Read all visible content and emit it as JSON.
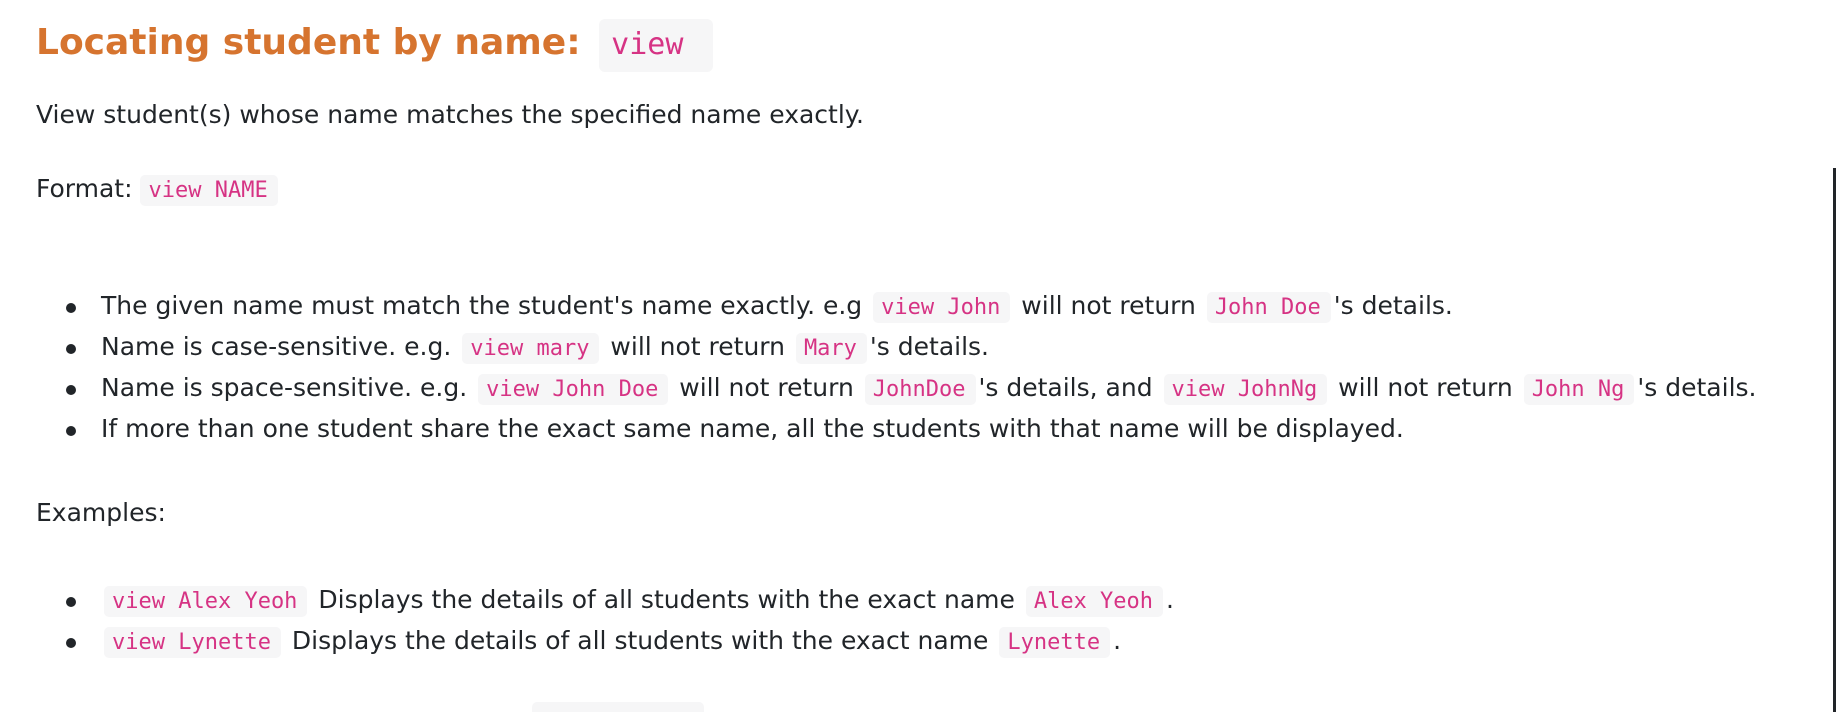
{
  "heading": {
    "text": "Locating student by name:",
    "command": "view"
  },
  "description": "View student(s) whose name matches the specified name exactly.",
  "format": {
    "label": "Format:",
    "code": "view NAME"
  },
  "rules": [
    {
      "t1": "The given name must match the student's name exactly. e.g",
      "c1": "view John",
      "t2": "will not return",
      "c2": "John Doe",
      "t3": "'s details."
    },
    {
      "t1": "Name is case-sensitive. e.g.",
      "c1": "view mary",
      "t2": "will not return",
      "c2": "Mary",
      "t3": "'s details."
    },
    {
      "t1": "Name is space-sensitive. e.g.",
      "c1": "view John Doe",
      "t2": "will not return",
      "c2": "JohnDoe",
      "t3": "'s details, and",
      "c3": "view JohnNg",
      "t4": "will not return",
      "c4": "John Ng",
      "t5": "'s details."
    },
    {
      "t1": "If more than one student share the exact same name, all the students with that name will be displayed."
    }
  ],
  "examples_label": "Examples:",
  "examples": [
    {
      "code": "view Alex Yeoh",
      "text": "Displays the details of all students with the exact name",
      "name": "Alex Yeoh",
      "end": "."
    },
    {
      "code": "view Lynette",
      "text": "Displays the details of all students with the exact name",
      "name": "Lynette",
      "end": "."
    }
  ]
}
